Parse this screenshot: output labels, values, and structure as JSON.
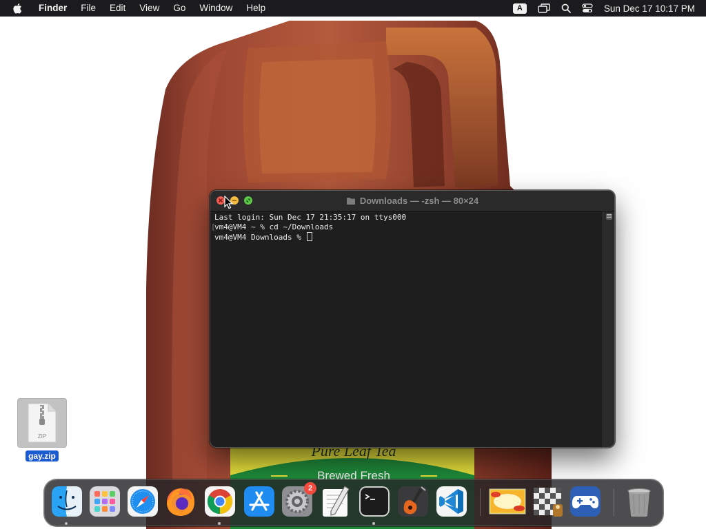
{
  "menubar": {
    "apple_icon": "apple-icon",
    "app_name": "Finder",
    "menus": [
      "File",
      "Edit",
      "View",
      "Go",
      "Window",
      "Help"
    ],
    "input_source": "A",
    "status_icons": [
      "input-source-icon",
      "screen-mirroring-icon",
      "spotlight-search-icon",
      "control-center-icon"
    ],
    "clock": "Sun Dec 17  10:17 PM"
  },
  "wallpaper": {
    "label_text": "Brewed Fresh",
    "script_text": "Pure Leaf Tea",
    "colors": {
      "jug": "#8e3f2c",
      "label_green": "#1f8a3a",
      "label_yellow": "#e8e23c"
    }
  },
  "terminal": {
    "title": "Downloads — -zsh — 80×24",
    "lines": [
      "Last login: Sun Dec 17 21:35:17 on ttys000",
      "vm4@VM4 ~ % cd ~/Downloads",
      "vm4@VM4 Downloads % "
    ]
  },
  "desktop": {
    "file_name": "gay.zip",
    "file_type_label": "ZIP"
  },
  "dock": {
    "apps": [
      {
        "name": "Finder",
        "icon": "finder-icon",
        "running": true
      },
      {
        "name": "Launchpad",
        "icon": "launchpad-icon",
        "running": false
      },
      {
        "name": "Safari",
        "icon": "safari-icon",
        "running": false
      },
      {
        "name": "Firefox",
        "icon": "firefox-icon",
        "running": false
      },
      {
        "name": "Google Chrome",
        "icon": "chrome-icon",
        "running": true
      },
      {
        "name": "App Store",
        "icon": "app-store-icon",
        "running": false
      },
      {
        "name": "System Settings",
        "icon": "system-settings-icon",
        "running": false,
        "badge": "2"
      },
      {
        "name": "TextEdit",
        "icon": "textedit-icon",
        "running": false
      },
      {
        "name": "Terminal",
        "icon": "terminal-icon",
        "running": true
      },
      {
        "name": "GarageBand",
        "icon": "garageband-icon",
        "running": false
      },
      {
        "name": "Visual Studio Code",
        "icon": "vscode-icon",
        "running": false
      }
    ],
    "others": [
      {
        "name": "Image thumbnail",
        "icon": "image-thumbnail-icon"
      },
      {
        "name": "Checkerboard app",
        "icon": "checkerboard-icon"
      },
      {
        "name": "Game controller app",
        "icon": "game-controller-icon"
      },
      {
        "name": "Trash",
        "icon": "trash-icon"
      }
    ]
  }
}
